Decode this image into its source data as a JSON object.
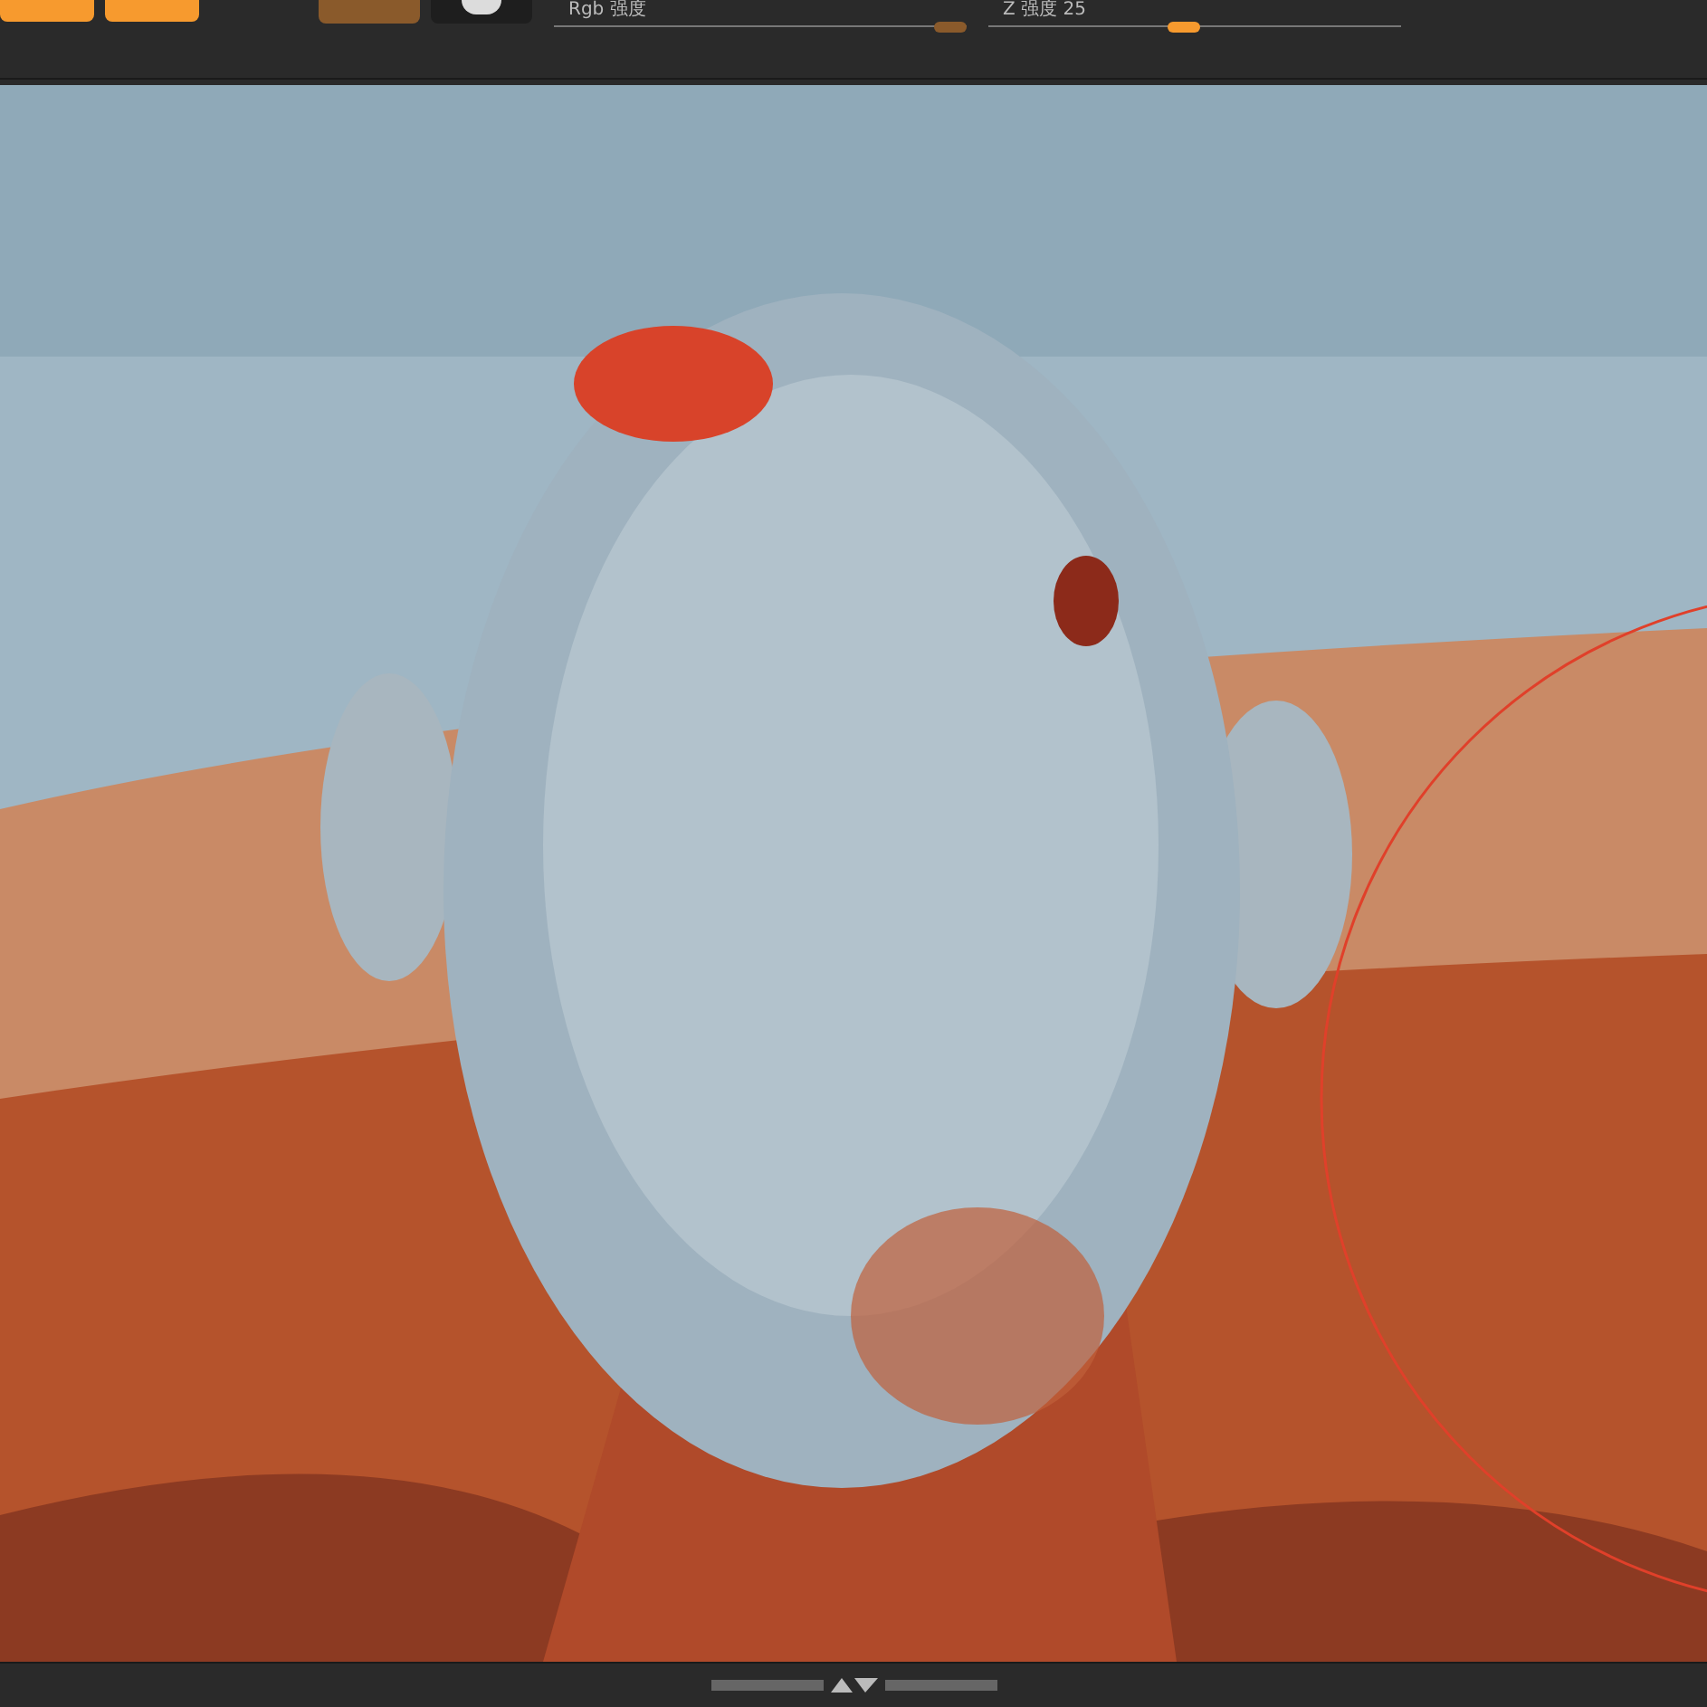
{
  "toolbar": {
    "buttons": [
      {
        "kind": "orange"
      },
      {
        "kind": "orange"
      },
      {
        "kind": "brown"
      },
      {
        "kind": "sphere"
      }
    ],
    "sliders": [
      {
        "label": "Rgb 强度",
        "level": 1
      },
      {
        "label": "Z 强度 25",
        "level": 0.47
      }
    ]
  }
}
